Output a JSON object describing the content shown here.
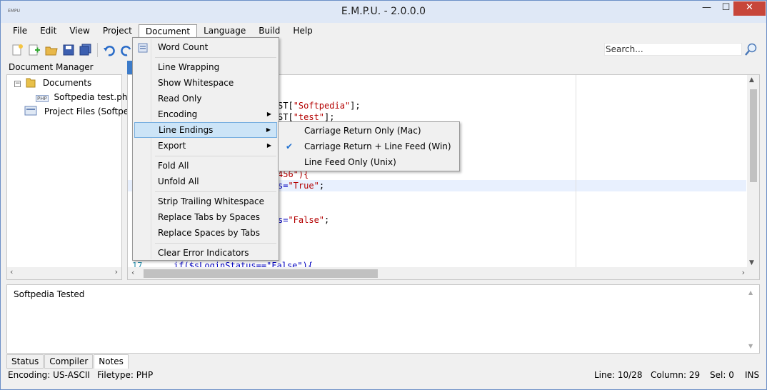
{
  "window": {
    "title": "E.M.P.U. - 2.0.0.0",
    "app_icon_text": "EMPU",
    "controls": {
      "minimize": "—",
      "maximize": "☐",
      "close": "✕"
    }
  },
  "menubar": {
    "items": [
      "File",
      "Edit",
      "View",
      "Project",
      "Document",
      "Language",
      "Build",
      "Help"
    ],
    "active": "Document"
  },
  "toolbar": {
    "icons": [
      "new-file-icon",
      "add-file-icon",
      "open-folder-icon",
      "save-icon",
      "save-all-icon",
      "undo-icon",
      "redo-icon"
    ],
    "search_placeholder": "Search..."
  },
  "document_manager": {
    "header": "Document Manager",
    "tree": {
      "root": "Documents",
      "file": "Softpedia test.php",
      "file_badge": "PHP",
      "project": "Project Files (Softped"
    }
  },
  "editor": {
    "code_fragments": {
      "l1_pre": "ST[",
      "l1_str": "\"Softpedia\"",
      "l1_post": "];",
      "l2_pre": "ST[",
      "l2_str": "\"test\"",
      "l2_post": "];",
      "l3": "456\"){",
      "l4_pre": "s=",
      "l4_str": "\"True\"",
      "l4_post": ";",
      "l5_pre": "s=",
      "l5_str": "\"False\"",
      "l5_post": ";",
      "l6_num": "17",
      "l6_code": "if($sLoginStatus==\"False\"){"
    }
  },
  "document_menu": {
    "items": {
      "word_count": "Word Count",
      "line_wrapping": "Line Wrapping",
      "show_whitespace": "Show Whitespace",
      "read_only": "Read Only",
      "encoding": "Encoding",
      "line_endings": "Line Endings",
      "export": "Export",
      "fold_all": "Fold All",
      "unfold_all": "Unfold All",
      "strip_trailing": "Strip Trailing Whitespace",
      "tabs_to_spaces": "Replace Tabs by Spaces",
      "spaces_to_tabs": "Replace Spaces by Tabs",
      "clear_errors": "Clear Error Indicators"
    },
    "arrow": "▶"
  },
  "line_endings_submenu": {
    "items": [
      "Carriage Return Only (Mac)",
      "Carriage Return + Line Feed (Win)",
      "Line Feed Only (Unix)"
    ],
    "checked_index": 1,
    "check": "✔"
  },
  "notes": {
    "text": "Softpedia Tested"
  },
  "bottom_tabs": [
    "Status",
    "Compiler",
    "Notes"
  ],
  "statusbar": {
    "encoding": "Encoding: US-ASCII",
    "filetype": "Filetype: PHP",
    "line": "Line: 10/28",
    "column": "Column: 29",
    "sel": "Sel: 0",
    "mode": "INS"
  },
  "colors": {
    "accent": "#3c7bc9",
    "hover": "#cce4f7",
    "string": "#b40000",
    "close": "#c7463a"
  }
}
